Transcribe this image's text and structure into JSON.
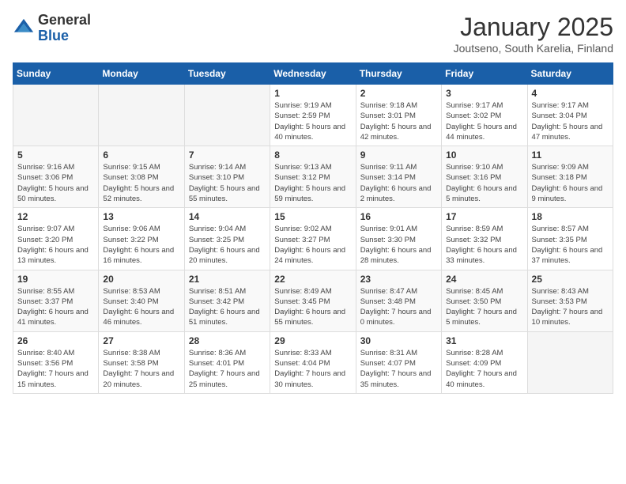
{
  "logo": {
    "general": "General",
    "blue": "Blue"
  },
  "title": "January 2025",
  "subtitle": "Joutseno, South Karelia, Finland",
  "days_header": [
    "Sunday",
    "Monday",
    "Tuesday",
    "Wednesday",
    "Thursday",
    "Friday",
    "Saturday"
  ],
  "weeks": [
    [
      {
        "day": "",
        "info": ""
      },
      {
        "day": "",
        "info": ""
      },
      {
        "day": "",
        "info": ""
      },
      {
        "day": "1",
        "info": "Sunrise: 9:19 AM\nSunset: 2:59 PM\nDaylight: 5 hours and 40 minutes."
      },
      {
        "day": "2",
        "info": "Sunrise: 9:18 AM\nSunset: 3:01 PM\nDaylight: 5 hours and 42 minutes."
      },
      {
        "day": "3",
        "info": "Sunrise: 9:17 AM\nSunset: 3:02 PM\nDaylight: 5 hours and 44 minutes."
      },
      {
        "day": "4",
        "info": "Sunrise: 9:17 AM\nSunset: 3:04 PM\nDaylight: 5 hours and 47 minutes."
      }
    ],
    [
      {
        "day": "5",
        "info": "Sunrise: 9:16 AM\nSunset: 3:06 PM\nDaylight: 5 hours and 50 minutes."
      },
      {
        "day": "6",
        "info": "Sunrise: 9:15 AM\nSunset: 3:08 PM\nDaylight: 5 hours and 52 minutes."
      },
      {
        "day": "7",
        "info": "Sunrise: 9:14 AM\nSunset: 3:10 PM\nDaylight: 5 hours and 55 minutes."
      },
      {
        "day": "8",
        "info": "Sunrise: 9:13 AM\nSunset: 3:12 PM\nDaylight: 5 hours and 59 minutes."
      },
      {
        "day": "9",
        "info": "Sunrise: 9:11 AM\nSunset: 3:14 PM\nDaylight: 6 hours and 2 minutes."
      },
      {
        "day": "10",
        "info": "Sunrise: 9:10 AM\nSunset: 3:16 PM\nDaylight: 6 hours and 5 minutes."
      },
      {
        "day": "11",
        "info": "Sunrise: 9:09 AM\nSunset: 3:18 PM\nDaylight: 6 hours and 9 minutes."
      }
    ],
    [
      {
        "day": "12",
        "info": "Sunrise: 9:07 AM\nSunset: 3:20 PM\nDaylight: 6 hours and 13 minutes."
      },
      {
        "day": "13",
        "info": "Sunrise: 9:06 AM\nSunset: 3:22 PM\nDaylight: 6 hours and 16 minutes."
      },
      {
        "day": "14",
        "info": "Sunrise: 9:04 AM\nSunset: 3:25 PM\nDaylight: 6 hours and 20 minutes."
      },
      {
        "day": "15",
        "info": "Sunrise: 9:02 AM\nSunset: 3:27 PM\nDaylight: 6 hours and 24 minutes."
      },
      {
        "day": "16",
        "info": "Sunrise: 9:01 AM\nSunset: 3:30 PM\nDaylight: 6 hours and 28 minutes."
      },
      {
        "day": "17",
        "info": "Sunrise: 8:59 AM\nSunset: 3:32 PM\nDaylight: 6 hours and 33 minutes."
      },
      {
        "day": "18",
        "info": "Sunrise: 8:57 AM\nSunset: 3:35 PM\nDaylight: 6 hours and 37 minutes."
      }
    ],
    [
      {
        "day": "19",
        "info": "Sunrise: 8:55 AM\nSunset: 3:37 PM\nDaylight: 6 hours and 41 minutes."
      },
      {
        "day": "20",
        "info": "Sunrise: 8:53 AM\nSunset: 3:40 PM\nDaylight: 6 hours and 46 minutes."
      },
      {
        "day": "21",
        "info": "Sunrise: 8:51 AM\nSunset: 3:42 PM\nDaylight: 6 hours and 51 minutes."
      },
      {
        "day": "22",
        "info": "Sunrise: 8:49 AM\nSunset: 3:45 PM\nDaylight: 6 hours and 55 minutes."
      },
      {
        "day": "23",
        "info": "Sunrise: 8:47 AM\nSunset: 3:48 PM\nDaylight: 7 hours and 0 minutes."
      },
      {
        "day": "24",
        "info": "Sunrise: 8:45 AM\nSunset: 3:50 PM\nDaylight: 7 hours and 5 minutes."
      },
      {
        "day": "25",
        "info": "Sunrise: 8:43 AM\nSunset: 3:53 PM\nDaylight: 7 hours and 10 minutes."
      }
    ],
    [
      {
        "day": "26",
        "info": "Sunrise: 8:40 AM\nSunset: 3:56 PM\nDaylight: 7 hours and 15 minutes."
      },
      {
        "day": "27",
        "info": "Sunrise: 8:38 AM\nSunset: 3:58 PM\nDaylight: 7 hours and 20 minutes."
      },
      {
        "day": "28",
        "info": "Sunrise: 8:36 AM\nSunset: 4:01 PM\nDaylight: 7 hours and 25 minutes."
      },
      {
        "day": "29",
        "info": "Sunrise: 8:33 AM\nSunset: 4:04 PM\nDaylight: 7 hours and 30 minutes."
      },
      {
        "day": "30",
        "info": "Sunrise: 8:31 AM\nSunset: 4:07 PM\nDaylight: 7 hours and 35 minutes."
      },
      {
        "day": "31",
        "info": "Sunrise: 8:28 AM\nSunset: 4:09 PM\nDaylight: 7 hours and 40 minutes."
      },
      {
        "day": "",
        "info": ""
      }
    ]
  ]
}
